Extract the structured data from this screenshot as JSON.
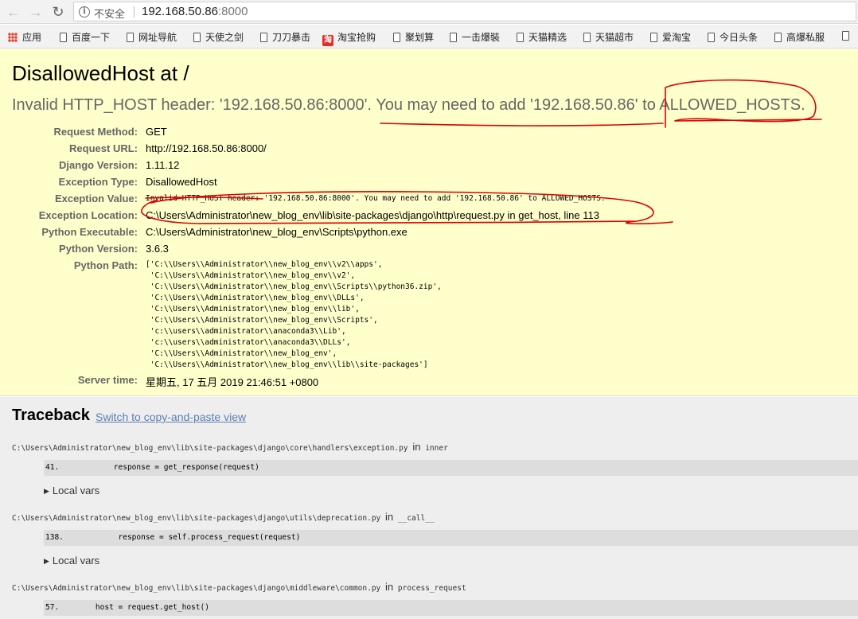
{
  "browser": {
    "security_label": "不安全",
    "url_host": "192.168.50.86",
    "url_port": ":8000"
  },
  "bookmarks": [
    {
      "label": "应用",
      "icon": "apps-grid-icon"
    },
    {
      "label": "百度一下",
      "icon": "page-icon"
    },
    {
      "label": "网址导航",
      "icon": "page-icon"
    },
    {
      "label": "天使之剑",
      "icon": "page-icon"
    },
    {
      "label": "刀刀暴击",
      "icon": "page-icon"
    },
    {
      "label": "淘宝抢购",
      "icon": "taobao-icon",
      "glyph": "淘"
    },
    {
      "label": "聚划算",
      "icon": "page-icon"
    },
    {
      "label": "一击爆裝",
      "icon": "page-icon"
    },
    {
      "label": "天猫精选",
      "icon": "page-icon"
    },
    {
      "label": "天猫超市",
      "icon": "page-icon"
    },
    {
      "label": "爱淘宝",
      "icon": "page-icon"
    },
    {
      "label": "今日头条",
      "icon": "page-icon"
    },
    {
      "label": "高爆私服",
      "icon": "page-icon"
    }
  ],
  "summary": {
    "title": "DisallowedHost at /",
    "subtitle": "Invalid HTTP_HOST header: '192.168.50.86:8000'. You may need to add '192.168.50.86' to ALLOWED_HOSTS.",
    "meta": [
      {
        "key": "Request Method:",
        "value": "GET"
      },
      {
        "key": "Request URL:",
        "value": "http://192.168.50.86:8000/"
      },
      {
        "key": "Django Version:",
        "value": "1.11.12"
      },
      {
        "key": "Exception Type:",
        "value": "DisallowedHost"
      },
      {
        "key": "Exception Value:",
        "value": "Invalid HTTP_HOST header: '192.168.50.86:8000'. You may need to add '192.168.50.86' to ALLOWED_HOSTS."
      },
      {
        "key": "Exception Location:",
        "value": "C:\\Users\\Administrator\\new_blog_env\\lib\\site-packages\\django\\http\\request.py in get_host, line 113"
      },
      {
        "key": "Python Executable:",
        "value": "C:\\Users\\Administrator\\new_blog_env\\Scripts\\python.exe"
      },
      {
        "key": "Python Version:",
        "value": "3.6.3"
      },
      {
        "key": "Python Path:",
        "value": ""
      },
      {
        "key": "Server time:",
        "value": "星期五, 17 五月 2019 21:46:51 +0800"
      }
    ],
    "python_path": [
      "['C:\\\\Users\\\\Administrator\\\\new_blog_env\\\\v2\\\\apps',",
      " 'C:\\\\Users\\\\Administrator\\\\new_blog_env\\\\v2',",
      " 'C:\\\\Users\\\\Administrator\\\\new_blog_env\\\\Scripts\\\\python36.zip',",
      " 'C:\\\\Users\\\\Administrator\\\\new_blog_env\\\\DLLs',",
      " 'C:\\\\Users\\\\Administrator\\\\new_blog_env\\\\lib',",
      " 'C:\\\\Users\\\\Administrator\\\\new_blog_env\\\\Scripts',",
      " 'c:\\\\users\\\\administrator\\\\anaconda3\\\\Lib',",
      " 'c:\\\\users\\\\administrator\\\\anaconda3\\\\DLLs',",
      " 'C:\\\\Users\\\\Administrator\\\\new_blog_env',",
      " 'C:\\\\Users\\\\Administrator\\\\new_blog_env\\\\lib\\\\site-packages']"
    ]
  },
  "traceback": {
    "title": "Traceback",
    "switch_label": "Switch to copy-and-paste view",
    "in_word": "in",
    "local_vars_label": "Local vars",
    "frames": [
      {
        "file": "C:\\Users\\Administrator\\new_blog_env\\lib\\site-packages\\django\\core\\handlers\\exception.py",
        "func": "inner",
        "line_no": "41.",
        "code": "            response = get_response(request)"
      },
      {
        "file": "C:\\Users\\Administrator\\new_blog_env\\lib\\site-packages\\django\\utils\\deprecation.py",
        "func": "__call__",
        "line_no": "138.",
        "code": "            response = self.process_request(request)"
      },
      {
        "file": "C:\\Users\\Administrator\\new_blog_env\\lib\\site-packages\\django\\middleware\\common.py",
        "func": "process_request",
        "line_no": "57.",
        "code": "        host = request.get_host()"
      }
    ]
  },
  "colors": {
    "summary_bg": "#ffffcc",
    "traceback_bg": "#eeeeee",
    "annotation_red": "#e00000",
    "link": "#5b80b2"
  }
}
